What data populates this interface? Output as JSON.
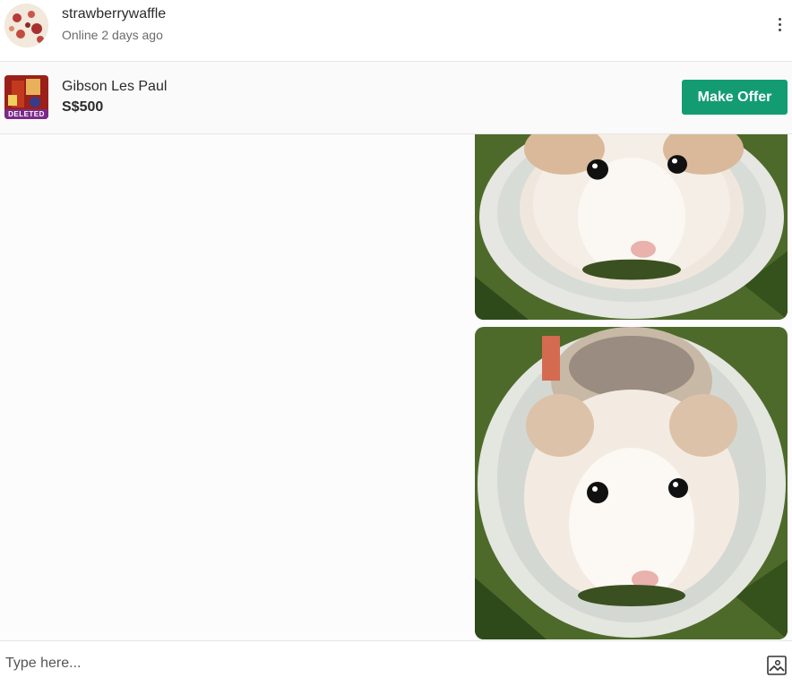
{
  "header": {
    "username": "strawberrywaffle",
    "status": "Online 2 days ago",
    "avatar_icon": "user-avatar",
    "menu_icon": "more-vertical-icon"
  },
  "listing": {
    "title": "Gibson Les Paul",
    "price": "S$500",
    "badge": "DELETED",
    "offer_button": "Make Offer",
    "accent_color": "#139c72"
  },
  "messages": [
    {
      "type": "image",
      "sender": "me",
      "subject": "hamster in plastic tube"
    },
    {
      "type": "image",
      "sender": "me",
      "subject": "hamster in plastic tube"
    }
  ],
  "composer": {
    "placeholder": "Type here...",
    "attach_icon": "image-upload-icon"
  }
}
